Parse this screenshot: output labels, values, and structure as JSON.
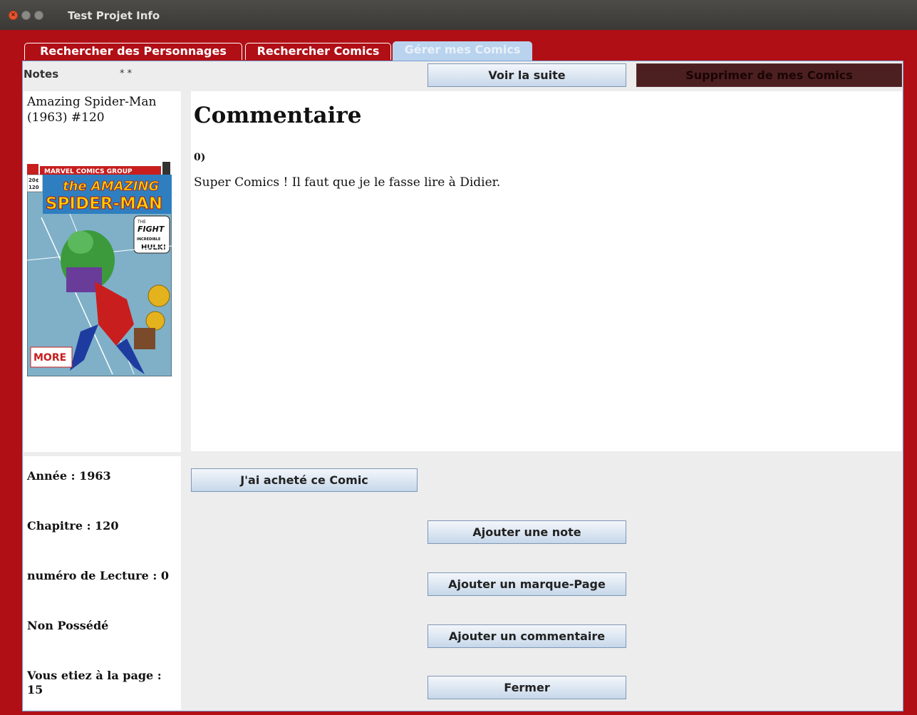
{
  "window": {
    "title": "Test Projet Info",
    "close_glyph": "×"
  },
  "tabs": [
    {
      "label": "Rechercher des Personnages"
    },
    {
      "label": "Rechercher Comics"
    },
    {
      "label": "Gérer mes Comics"
    }
  ],
  "toolbar": {
    "notes_label": "Notes",
    "notes_value": "* *",
    "voir_label": "Voir la suite",
    "supprimer_label": "Supprimer de mes Comics"
  },
  "comic": {
    "title": "Amazing Spider-Man (1963) #120",
    "cover": {
      "publisher": "MARVEL COMICS GROUP",
      "headline_1": "the AMAZING",
      "headline_2": "SPIDER-MAN",
      "tagline_1": "THE",
      "tagline_2": "FIGHT",
      "tagline_3": "INCREDIBLE",
      "tagline_4": "HULK!",
      "corner_price": "20¢",
      "corner_issue": "120",
      "bottom_label": "MORE"
    }
  },
  "comment": {
    "heading": "Commentaire",
    "index": "0)",
    "text": "Super Comics ! Il faut que je le fasse lire à Didier."
  },
  "info": {
    "annee": "Année : 1963",
    "chapitre": "Chapitre : 120",
    "lecture": "numéro de Lecture : 0",
    "possession": "Non Possédé",
    "page": "Vous etiez à la page : 15"
  },
  "actions": {
    "achete": "J'ai acheté ce Comic",
    "note": "Ajouter une note",
    "marque": "Ajouter un marque-Page",
    "commentaire": "Ajouter un commentaire",
    "fermer": "Fermer"
  },
  "colors": {
    "frame_red": "#b10f16",
    "titlebar": "#3f3e3a",
    "delete_button": "#4c1f20",
    "active_tab": "#b9d3ee"
  }
}
